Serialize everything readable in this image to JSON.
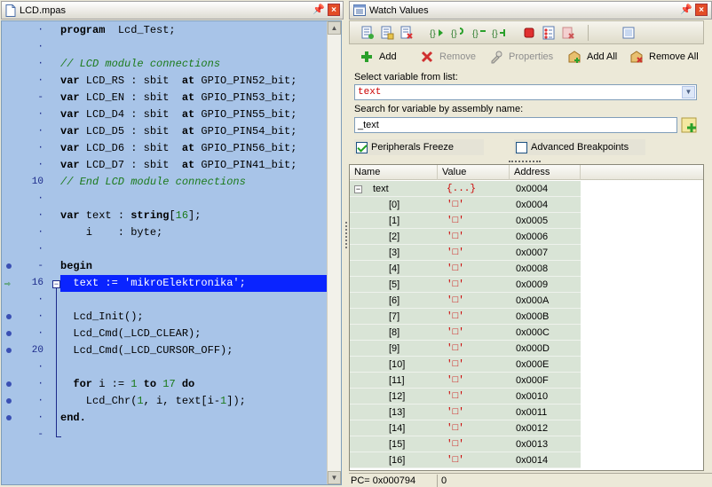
{
  "editor": {
    "tab_title": "LCD.mpas",
    "gutter": [
      {
        "num": "·",
        "bp": false,
        "arrow": false
      },
      {
        "num": "·",
        "bp": false,
        "arrow": false
      },
      {
        "num": "·",
        "bp": false,
        "arrow": false
      },
      {
        "num": "·",
        "bp": false,
        "arrow": false
      },
      {
        "num": "-",
        "bp": false,
        "arrow": false
      },
      {
        "num": "·",
        "bp": false,
        "arrow": false
      },
      {
        "num": "·",
        "bp": false,
        "arrow": false
      },
      {
        "num": "·",
        "bp": false,
        "arrow": false
      },
      {
        "num": "·",
        "bp": false,
        "arrow": false
      },
      {
        "num": "10",
        "bp": false,
        "arrow": false
      },
      {
        "num": "·",
        "bp": false,
        "arrow": false
      },
      {
        "num": "·",
        "bp": false,
        "arrow": false
      },
      {
        "num": "·",
        "bp": false,
        "arrow": false
      },
      {
        "num": "·",
        "bp": false,
        "arrow": false
      },
      {
        "num": "-",
        "bp": true,
        "arrow": false
      },
      {
        "num": "16",
        "bp": false,
        "arrow": true
      },
      {
        "num": "·",
        "bp": false,
        "arrow": false
      },
      {
        "num": "·",
        "bp": true,
        "arrow": false
      },
      {
        "num": "·",
        "bp": true,
        "arrow": false
      },
      {
        "num": "20",
        "bp": true,
        "arrow": false
      },
      {
        "num": "·",
        "bp": false,
        "arrow": false
      },
      {
        "num": "·",
        "bp": true,
        "arrow": false
      },
      {
        "num": "·",
        "bp": true,
        "arrow": false
      },
      {
        "num": "·",
        "bp": true,
        "arrow": false
      },
      {
        "num": "-",
        "bp": false,
        "arrow": false
      }
    ],
    "lines": [
      [
        {
          "t": "program",
          "c": "kw"
        },
        {
          "t": "  Lcd_Test;",
          "c": ""
        }
      ],
      [],
      [
        {
          "t": "// LCD module connections",
          "c": "cm"
        }
      ],
      [
        {
          "t": "var",
          "c": "kw"
        },
        {
          "t": " LCD_RS : sbit  ",
          "c": ""
        },
        {
          "t": "at",
          "c": "kw"
        },
        {
          "t": " GPIO_PIN52_bit;",
          "c": ""
        }
      ],
      [
        {
          "t": "var",
          "c": "kw"
        },
        {
          "t": " LCD_EN : sbit  ",
          "c": ""
        },
        {
          "t": "at",
          "c": "kw"
        },
        {
          "t": " GPIO_PIN53_bit;",
          "c": ""
        }
      ],
      [
        {
          "t": "var",
          "c": "kw"
        },
        {
          "t": " LCD_D4 : sbit  ",
          "c": ""
        },
        {
          "t": "at",
          "c": "kw"
        },
        {
          "t": " GPIO_PIN55_bit;",
          "c": ""
        }
      ],
      [
        {
          "t": "var",
          "c": "kw"
        },
        {
          "t": " LCD_D5 : sbit  ",
          "c": ""
        },
        {
          "t": "at",
          "c": "kw"
        },
        {
          "t": " GPIO_PIN54_bit;",
          "c": ""
        }
      ],
      [
        {
          "t": "var",
          "c": "kw"
        },
        {
          "t": " LCD_D6 : sbit  ",
          "c": ""
        },
        {
          "t": "at",
          "c": "kw"
        },
        {
          "t": " GPIO_PIN56_bit;",
          "c": ""
        }
      ],
      [
        {
          "t": "var",
          "c": "kw"
        },
        {
          "t": " LCD_D7 : sbit  ",
          "c": ""
        },
        {
          "t": "at",
          "c": "kw"
        },
        {
          "t": " GPIO_PIN41_bit;",
          "c": ""
        }
      ],
      [
        {
          "t": "// End LCD module connections",
          "c": "cm"
        }
      ],
      [],
      [
        {
          "t": "var",
          "c": "kw"
        },
        {
          "t": " text : ",
          "c": ""
        },
        {
          "t": "string",
          "c": "kw"
        },
        {
          "t": "[",
          "c": ""
        },
        {
          "t": "16",
          "c": "nm"
        },
        {
          "t": "];",
          "c": ""
        }
      ],
      [
        {
          "t": "    i    : byte;",
          "c": ""
        }
      ],
      [],
      [
        {
          "t": "begin",
          "c": "kw"
        }
      ],
      [
        {
          "t": "  text := ",
          "c": ""
        },
        {
          "t": "'mikroElektronika'",
          "c": "str"
        },
        {
          "t": ";",
          "c": ""
        }
      ],
      [],
      [
        {
          "t": "  Lcd_Init();",
          "c": ""
        }
      ],
      [
        {
          "t": "  Lcd_Cmd(_LCD_CLEAR);",
          "c": ""
        }
      ],
      [
        {
          "t": "  Lcd_Cmd(_LCD_CURSOR_OFF);",
          "c": ""
        }
      ],
      [],
      [
        {
          "t": "  ",
          "c": ""
        },
        {
          "t": "for",
          "c": "kw"
        },
        {
          "t": " i := ",
          "c": ""
        },
        {
          "t": "1",
          "c": "nm"
        },
        {
          "t": " ",
          "c": ""
        },
        {
          "t": "to",
          "c": "kw"
        },
        {
          "t": " ",
          "c": ""
        },
        {
          "t": "17",
          "c": "nm"
        },
        {
          "t": " ",
          "c": ""
        },
        {
          "t": "do",
          "c": "kw"
        }
      ],
      [
        {
          "t": "    Lcd_Chr(",
          "c": ""
        },
        {
          "t": "1",
          "c": "nm"
        },
        {
          "t": ", i, text[i-",
          "c": ""
        },
        {
          "t": "1",
          "c": "nm"
        },
        {
          "t": "]);",
          "c": ""
        }
      ],
      [
        {
          "t": "end.",
          "c": "kw"
        }
      ],
      []
    ],
    "active_line": 15
  },
  "watch": {
    "tab_title": "Watch Values",
    "actions": {
      "add": "Add",
      "remove": "Remove",
      "properties": "Properties",
      "add_all": "Add All",
      "remove_all": "Remove All"
    },
    "select_label": "Select variable from list:",
    "select_value": "text",
    "search_label": "Search for variable by assembly name:",
    "search_value": "_text",
    "peripherals_freeze": "Peripherals Freeze",
    "advanced_breakpoints": "Advanced Breakpoints",
    "columns": [
      "Name",
      "Value",
      "Address"
    ],
    "rows": [
      {
        "name": "text",
        "value": "{...}",
        "address": "0x0004",
        "root": true
      },
      {
        "name": "[0]",
        "value": "'□'",
        "address": "0x0004"
      },
      {
        "name": "[1]",
        "value": "'□'",
        "address": "0x0005"
      },
      {
        "name": "[2]",
        "value": "'□'",
        "address": "0x0006"
      },
      {
        "name": "[3]",
        "value": "'□'",
        "address": "0x0007"
      },
      {
        "name": "[4]",
        "value": "'□'",
        "address": "0x0008"
      },
      {
        "name": "[5]",
        "value": "'□'",
        "address": "0x0009"
      },
      {
        "name": "[6]",
        "value": "'□'",
        "address": "0x000A"
      },
      {
        "name": "[7]",
        "value": "'□'",
        "address": "0x000B"
      },
      {
        "name": "[8]",
        "value": "'□'",
        "address": "0x000C"
      },
      {
        "name": "[9]",
        "value": "'□'",
        "address": "0x000D"
      },
      {
        "name": "[10]",
        "value": "'□'",
        "address": "0x000E"
      },
      {
        "name": "[11]",
        "value": "'□'",
        "address": "0x000F"
      },
      {
        "name": "[12]",
        "value": "'□'",
        "address": "0x0010"
      },
      {
        "name": "[13]",
        "value": "'□'",
        "address": "0x0011"
      },
      {
        "name": "[14]",
        "value": "'□'",
        "address": "0x0012"
      },
      {
        "name": "[15]",
        "value": "'□'",
        "address": "0x0013"
      },
      {
        "name": "[16]",
        "value": "'□'",
        "address": "0x0014"
      }
    ],
    "status_pc": "PC= 0x000794",
    "status_value": "0"
  }
}
